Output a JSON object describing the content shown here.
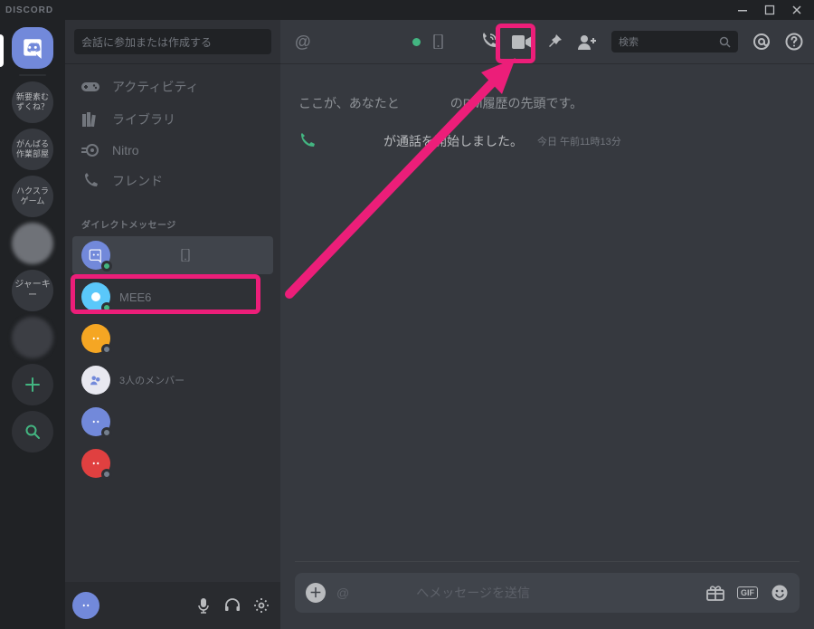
{
  "titlebar": {
    "wordmark": "DISCORD"
  },
  "rail": {
    "servers": [
      {
        "label": "新要素むずくね？"
      },
      {
        "label": "がんばる作業部屋"
      },
      {
        "label": "ハクスラゲーム"
      }
    ],
    "server_text2": "ジャーキー"
  },
  "col2": {
    "search_placeholder": "会話に参加または作成する",
    "nav": {
      "activity": "アクティビティ",
      "library": "ライブラリ",
      "nitro": "Nitro",
      "friends": "フレンド"
    },
    "dm_header": "ダイレクトメッセージ",
    "dms": [
      {
        "name": "　　　　",
        "status": "online",
        "selected": true,
        "color": "#7289da",
        "mobile": true
      },
      {
        "name": "MEE6",
        "status": "online",
        "selected": false,
        "color": "#5ac8fa"
      },
      {
        "name": "　　",
        "status": "offline",
        "selected": false,
        "color": "#f5a623"
      },
      {
        "name": "3人のメンバー",
        "status": "none",
        "selected": false,
        "color": "#e8e8f0"
      },
      {
        "name": "　　",
        "status": "offline",
        "selected": false,
        "color": "#7289da"
      },
      {
        "name": "　　",
        "status": "offline",
        "selected": false,
        "color": "#e04040"
      }
    ],
    "user_panel_name": "　　　"
  },
  "topbar": {
    "at": "@",
    "username": "　　　　　　",
    "search_placeholder": "検索"
  },
  "chat": {
    "dm_start_prefix": "ここが、あなたと",
    "dm_start_mid": "　　　　",
    "dm_start_suffix": "のDM履歴の先頭です。",
    "call_who": "　　",
    "call_mid_blur": "　　",
    "call_text": "が通話を開始しました。",
    "call_time": "今日 午前11時13分"
  },
  "composer": {
    "ph_prefix": "@",
    "ph_blur": "　　　　　",
    "ph_suffix": "へメッセージを送信",
    "gif_label": "GIF"
  }
}
